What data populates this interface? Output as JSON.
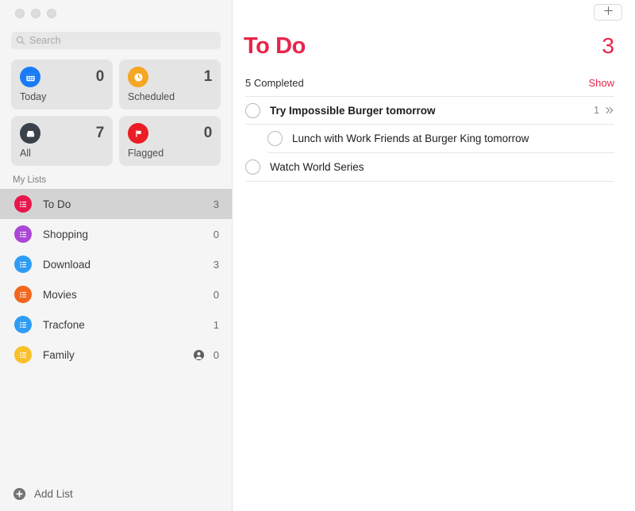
{
  "window": {
    "traffic_lights": [
      "close",
      "minimize",
      "zoom"
    ]
  },
  "sidebar": {
    "search": {
      "placeholder": "Search",
      "value": "",
      "icon": "search-icon"
    },
    "smart_lists": [
      {
        "label": "Today",
        "count": "0",
        "icon": "calendar-icon",
        "color": "#1a7cf5"
      },
      {
        "label": "Scheduled",
        "count": "1",
        "icon": "clock-icon",
        "color": "#f5a623"
      },
      {
        "label": "All",
        "count": "7",
        "icon": "inbox-icon",
        "color": "#3a4149"
      },
      {
        "label": "Flagged",
        "count": "0",
        "icon": "flag-icon",
        "color": "#ec1c24"
      }
    ],
    "my_lists_header": "My Lists",
    "lists": [
      {
        "label": "To Do",
        "count": "3",
        "color": "#e8174b",
        "selected": true,
        "shared": false
      },
      {
        "label": "Shopping",
        "count": "0",
        "color": "#ab47d6",
        "selected": false,
        "shared": false
      },
      {
        "label": "Download",
        "count": "3",
        "color": "#2f9cf4",
        "selected": false,
        "shared": false
      },
      {
        "label": "Movies",
        "count": "0",
        "color": "#f2671f",
        "selected": false,
        "shared": false
      },
      {
        "label": "Tracfone",
        "count": "1",
        "color": "#2f9cf4",
        "selected": false,
        "shared": false
      },
      {
        "label": "Family",
        "count": "0",
        "color": "#f8c12c",
        "selected": false,
        "shared": true
      }
    ],
    "add_list": {
      "label": "Add List",
      "icon": "plus-circle-icon"
    }
  },
  "main": {
    "toolbar": {
      "add_reminder_icon": "plus-icon"
    },
    "title": "To Do",
    "total_count": "3",
    "completed_label": "5 Completed",
    "show_label": "Show",
    "accent_color": "#e8254b",
    "tasks": [
      {
        "title": "Try Impossible Burger tomorrow",
        "bold": true,
        "sub": false,
        "subtask_count": "1",
        "has_chevron": true
      },
      {
        "title": "Lunch with Work Friends at Burger King tomorrow",
        "bold": false,
        "sub": true,
        "subtask_count": "",
        "has_chevron": false
      },
      {
        "title": "Watch World Series",
        "bold": false,
        "sub": false,
        "subtask_count": "",
        "has_chevron": false
      }
    ]
  }
}
